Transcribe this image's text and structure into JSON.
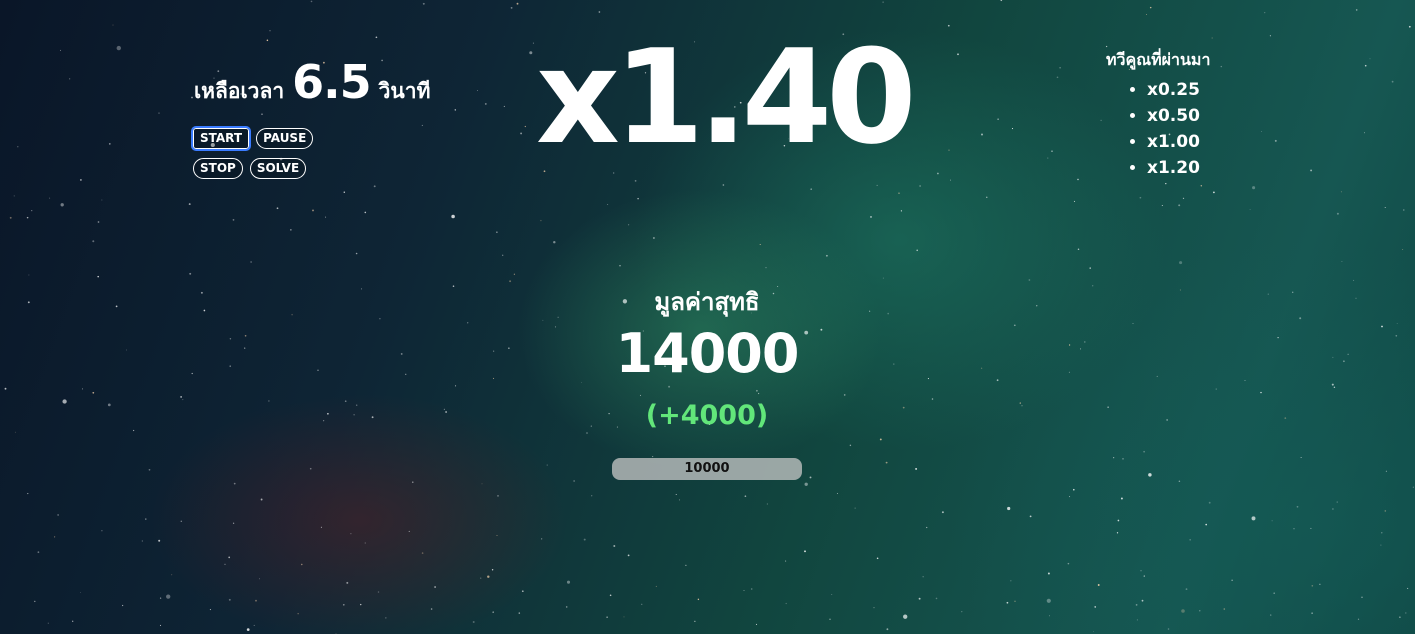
{
  "timer": {
    "label": "เหลือเวลา",
    "value": "6.5",
    "unit": "วินาที"
  },
  "controls": {
    "start_label": "START",
    "pause_label": "PAUSE",
    "stop_label": "STOP",
    "solve_label": "SOLVE"
  },
  "multiplier": {
    "current": "x1.40"
  },
  "history": {
    "title": "ทวีคูณที่ผ่านมา",
    "items": [
      "x0.25",
      "x0.50",
      "x1.00",
      "x1.20"
    ]
  },
  "result": {
    "net_label": "มูลค่าสุทธิ",
    "net_value": "14000",
    "delta": "(+4000)",
    "bet_value": "10000"
  },
  "colors": {
    "delta_green": "#62e67a",
    "focus_blue": "#3a7bff",
    "background_teal": "#165752",
    "background_navy": "#0a1628"
  }
}
